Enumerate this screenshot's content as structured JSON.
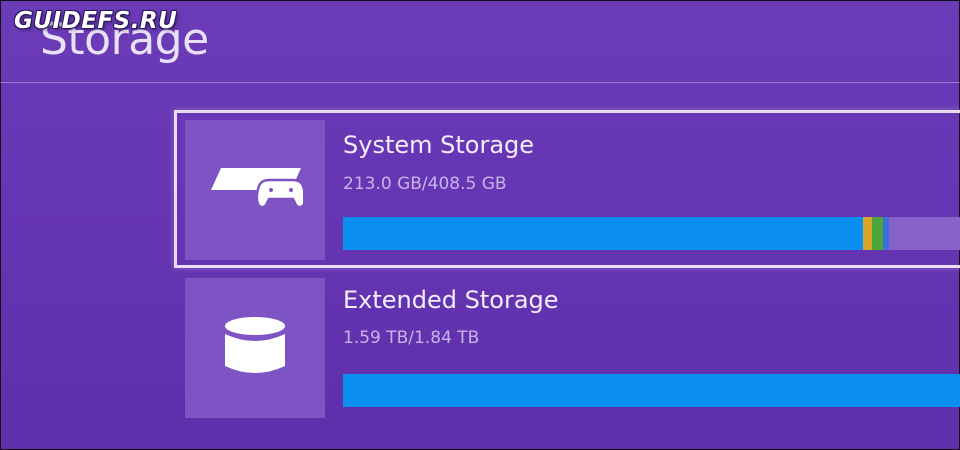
{
  "watermark": "GUIDEFS.RU",
  "header": {
    "title": "Storage"
  },
  "storage_items": [
    {
      "name": "System Storage",
      "size_text": "213.0 GB/408.5 GB",
      "icon": "ps4-console-controller-icon",
      "selected": true,
      "main_fill_fraction": 0.838,
      "other_segments": [
        {
          "color": "#d8a52a",
          "fraction": 0.014
        },
        {
          "color": "#4aa63a",
          "fraction": 0.018
        },
        {
          "color": "#3d6fd8",
          "fraction": 0.01
        }
      ]
    },
    {
      "name": "Extended Storage",
      "size_text": "1.59 TB/1.84 TB",
      "icon": "storage-cylinder-icon",
      "selected": false,
      "main_fill_fraction": 1.0,
      "other_segments": []
    }
  ],
  "colors": {
    "background": "#6635b3",
    "bar_fill": "#0a8ff0",
    "bar_track": "#8762c8",
    "tile": "#7e54c4"
  }
}
